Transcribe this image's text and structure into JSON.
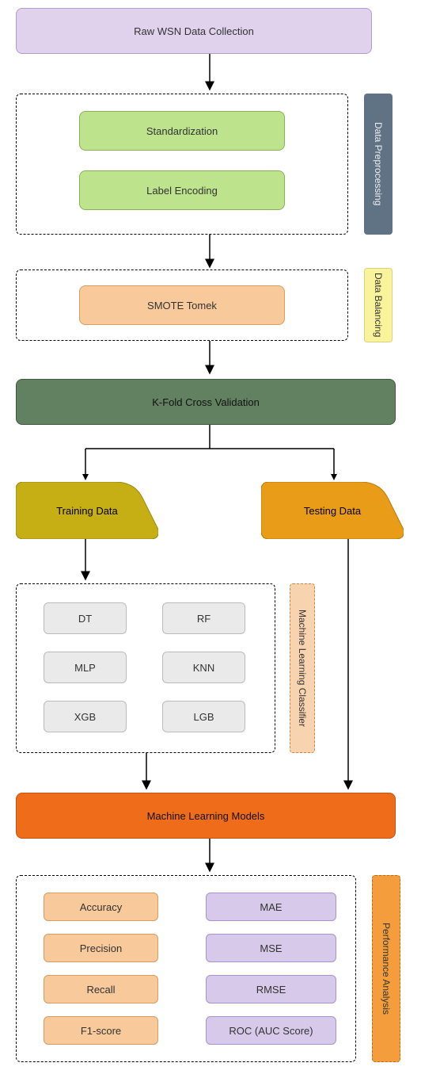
{
  "chart_data": {
    "type": "flow-diagram",
    "nodes": [
      {
        "id": "raw",
        "label": "Raw WSN Data Collection",
        "fill": "#E0D2EC"
      },
      {
        "id": "std",
        "label": "Standardization",
        "fill": "#BEE38D"
      },
      {
        "id": "label",
        "label": "Label Encoding",
        "fill": "#BEE38D"
      },
      {
        "id": "smote",
        "label": "SMOTE Tomek",
        "fill": "#F8C99A"
      },
      {
        "id": "kfold",
        "label": "K-Fold Cross Validation",
        "fill": "#628160"
      },
      {
        "id": "train",
        "label": "Training Data",
        "fill": "#C6AE15"
      },
      {
        "id": "test",
        "label": "Testing Data",
        "fill": "#E89C17"
      },
      {
        "id": "dt",
        "label": "DT",
        "fill": "#EAEAEA"
      },
      {
        "id": "rf",
        "label": "RF",
        "fill": "#EAEAEA"
      },
      {
        "id": "mlp",
        "label": "MLP",
        "fill": "#EAEAEA"
      },
      {
        "id": "knn",
        "label": "KNN",
        "fill": "#EAEAEA"
      },
      {
        "id": "xgb",
        "label": "XGB",
        "fill": "#EAEAEA"
      },
      {
        "id": "lgb",
        "label": "LGB",
        "fill": "#EAEAEA"
      },
      {
        "id": "mlm",
        "label": "Machine Learning Models",
        "fill": "#EF6C1A"
      },
      {
        "id": "acc",
        "label": "Accuracy",
        "fill": "#F8C99A"
      },
      {
        "id": "prec",
        "label": "Precision",
        "fill": "#F8C99A"
      },
      {
        "id": "rec",
        "label": "Recall",
        "fill": "#F8C99A"
      },
      {
        "id": "f1",
        "label": "F1-score",
        "fill": "#F8C99A"
      },
      {
        "id": "mae",
        "label": "MAE",
        "fill": "#D7C9E9"
      },
      {
        "id": "mse",
        "label": "MSE",
        "fill": "#D7C9E9"
      },
      {
        "id": "rmse",
        "label": "RMSE",
        "fill": "#D7C9E9"
      },
      {
        "id": "roc",
        "label": "ROC (AUC Score)",
        "fill": "#D7C9E9"
      }
    ],
    "groups": [
      {
        "id": "g-pre",
        "label": "Data Preprocessing",
        "fill": "#5F7384",
        "labelColor": "#eee"
      },
      {
        "id": "g-bal",
        "label": "Data Balancing",
        "fill": "#F9F49C",
        "labelColor": "#333"
      },
      {
        "id": "g-clf",
        "label": "Machine Learning Classifier",
        "fill": "#F7D3B0",
        "labelColor": "#333",
        "dashed": true
      },
      {
        "id": "g-perf",
        "label": "Performance  Analysis",
        "fill": "#F39D3C",
        "labelColor": "#333",
        "dashed": true
      }
    ],
    "edges": [
      [
        "raw",
        "g-pre"
      ],
      [
        "g-pre",
        "g-bal"
      ],
      [
        "g-bal",
        "kfold"
      ],
      [
        "kfold",
        "train"
      ],
      [
        "kfold",
        "test"
      ],
      [
        "train",
        "g-clf"
      ],
      [
        "g-clf",
        "mlm"
      ],
      [
        "test",
        "mlm"
      ],
      [
        "mlm",
        "g-perf"
      ]
    ]
  }
}
